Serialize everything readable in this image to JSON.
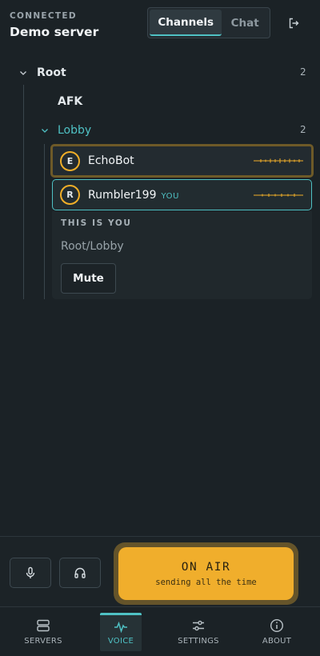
{
  "header": {
    "status": "CONNECTED",
    "server_name": "Demo server",
    "tabs": [
      {
        "label": "Channels",
        "active": true
      },
      {
        "label": "Chat",
        "active": false
      }
    ],
    "logout_icon": "logout-icon"
  },
  "tree": {
    "root": {
      "name": "Root",
      "count": "2"
    },
    "channels": [
      {
        "name": "AFK"
      },
      {
        "name": "Lobby",
        "count": "2",
        "active_color": "#4fc1c4"
      }
    ],
    "users": [
      {
        "initial": "E",
        "name": "EchoBot",
        "talking": true
      },
      {
        "initial": "R",
        "name": "Rumbler199",
        "you_tag": "YOU",
        "self": true
      }
    ]
  },
  "details": {
    "label": "THIS IS YOU",
    "path": "Root/Lobby",
    "mute_label": "Mute"
  },
  "controls": {
    "mic_icon": "microphone-icon",
    "headphones_icon": "headphones-icon",
    "on_air_title": "ON AIR",
    "on_air_subtitle": "sending all the time",
    "accent": "#f0ae2c"
  },
  "nav": {
    "items": [
      {
        "label": "SERVERS",
        "icon": "servers-icon"
      },
      {
        "label": "VOICE",
        "icon": "voice-icon",
        "active": true
      },
      {
        "label": "SETTINGS",
        "icon": "settings-icon"
      },
      {
        "label": "ABOUT",
        "icon": "info-icon"
      }
    ]
  },
  "colors": {
    "background": "#1b2226",
    "teal_accent": "#4fc1c4",
    "amber_accent": "#f0ae28"
  }
}
